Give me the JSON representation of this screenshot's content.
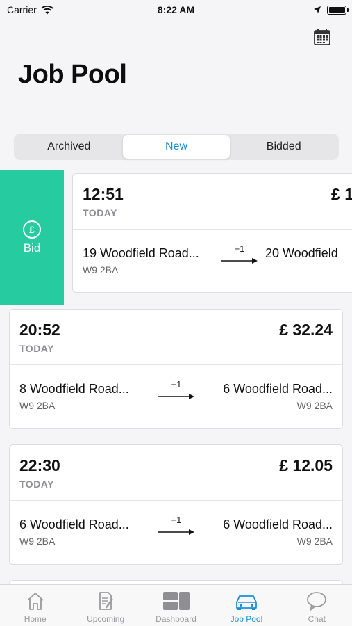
{
  "status_bar": {
    "carrier": "Carrier",
    "time": "8:22 AM"
  },
  "header": {
    "title": "Job Pool",
    "calendar_icon": "calendar-icon"
  },
  "segments": [
    {
      "label": "Archived",
      "active": false
    },
    {
      "label": "New",
      "active": true
    },
    {
      "label": "Bidded",
      "active": false
    }
  ],
  "bid_action": {
    "label": "Bid",
    "icon_symbol": "£"
  },
  "jobs": [
    {
      "time": "12:51",
      "day": "TODAY",
      "price": "£ 1",
      "from_address": "19 Woodfield Road...",
      "from_postcode": "W9 2BA",
      "stops": "+1",
      "to_address": "20 Woodfield",
      "to_postcode": ""
    },
    {
      "time": "20:52",
      "day": "TODAY",
      "price": "£ 32.24",
      "from_address": "8 Woodfield Road...",
      "from_postcode": "W9 2BA",
      "stops": "+1",
      "to_address": "6 Woodfield Road...",
      "to_postcode": "W9 2BA"
    },
    {
      "time": "22:30",
      "day": "TODAY",
      "price": "£ 12.05",
      "from_address": "6 Woodfield Road...",
      "from_postcode": "W9 2BA",
      "stops": "+1",
      "to_address": "6 Woodfield Road...",
      "to_postcode": "W9 2BA"
    }
  ],
  "tab_bar": [
    {
      "label": "Home",
      "icon": "home-icon",
      "active": false
    },
    {
      "label": "Upcoming",
      "icon": "clipboard-icon",
      "active": false
    },
    {
      "label": "Dashboard",
      "icon": "dashboard-icon",
      "active": false
    },
    {
      "label": "Job Pool",
      "icon": "car-icon",
      "active": true
    },
    {
      "label": "Chat",
      "icon": "chat-icon",
      "active": false
    }
  ],
  "colors": {
    "accent": "#1a8fe0",
    "bid_green": "#26cba0",
    "inactive": "#9a9a9e"
  }
}
